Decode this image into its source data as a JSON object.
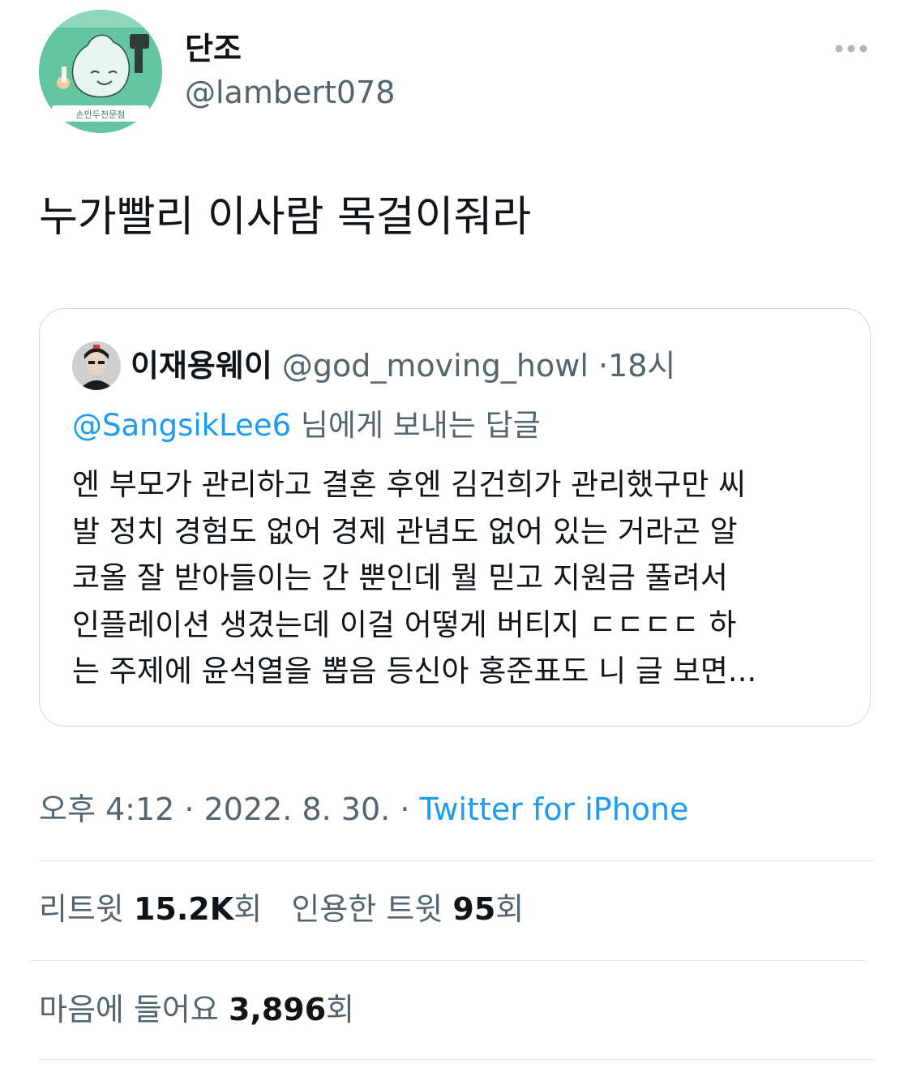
{
  "author": {
    "display_name": "단조",
    "handle": "@lambert078",
    "avatar_sign_text": "손만두전문점"
  },
  "tweet": {
    "text": "누가빨리 이사람 목걸이줘라"
  },
  "quoted": {
    "name": "이재용웨이",
    "handle": "@god_moving_howl",
    "separator": "·",
    "time": "18시",
    "reply_mention": "@SangsikLee6",
    "reply_suffix": " 님에게 보내는 답글",
    "lines": [
      "엔 부모가 관리하고 결혼 후엔 김건희가 관리했구만 씨",
      "발 정치 경험도 없어 경제 관념도 없어 있는 거라곤 알",
      "코올 잘 받아들이는 간 뿐인데 뭘 믿고 지원금 풀려서",
      "인플레이션 생겼는데 이걸 어떻게 버티지 ㄷㄷㄷㄷ 하",
      "는 주제에 윤석열을 뽑음 등신아 홍준표도 니 글 보면..."
    ]
  },
  "meta": {
    "time": "오후 4:12",
    "date": "2022. 8. 30.",
    "source": "Twitter for iPhone"
  },
  "stats": {
    "retweets_label": "리트윗",
    "retweets_value": "15.2K",
    "quotes_label": "인용한 트윗",
    "quotes_value": "95",
    "likes_label": "마음에 들어요",
    "likes_value": "3,896",
    "count_suffix": "회"
  },
  "colors": {
    "link": "#1d9bf0",
    "secondary_text": "#536471",
    "primary_text": "#0f1419",
    "border": "#cfd9de",
    "avatar_bg": "#5cc29a"
  },
  "icons": {
    "more": "more-horizontal-icon"
  }
}
